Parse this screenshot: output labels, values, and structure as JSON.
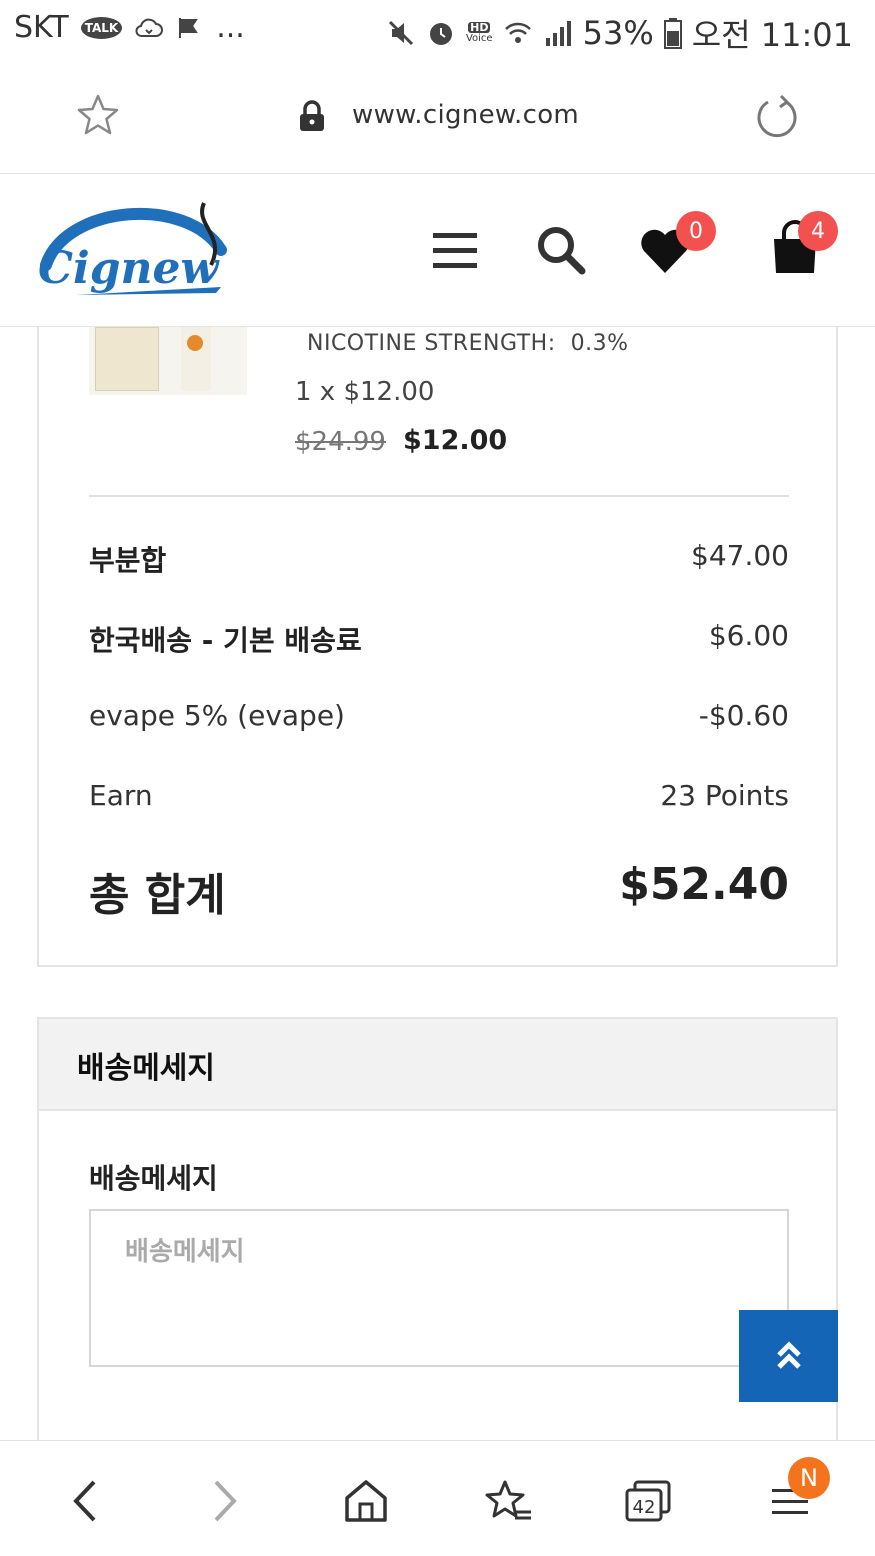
{
  "statusbar": {
    "carrier": "SKT",
    "talk_badge": "TALK",
    "more": "...",
    "hd_label": "HD",
    "voice_label": "Voice",
    "battery": "53%",
    "time": "오전 11:01"
  },
  "addressbar": {
    "url": "www.cignew.com"
  },
  "header": {
    "logo_text": "Cignew",
    "wishlist_count": "0",
    "cart_count": "4"
  },
  "order": {
    "nicotine_label": "NICOTINE STRENGTH:",
    "nicotine_value": "0.3%",
    "quantity_line": "1 x $12.00",
    "old_price": "$24.99",
    "new_price": "$12.00",
    "rows": [
      {
        "label": "부분합",
        "value": "$47.00"
      },
      {
        "label": "한국배송 - 기본 배송료",
        "value": "$6.00"
      },
      {
        "label": "evape 5% (evape)",
        "value": "-$0.60"
      },
      {
        "label": "Earn",
        "value": "23 Points"
      }
    ],
    "total_label": "총 합계",
    "total_value": "$52.40"
  },
  "shipping_message": {
    "section_title": "배송메세지",
    "field_label": "배송메세지",
    "placeholder": "배송메세지"
  },
  "bottomnav": {
    "tabs_count": "42",
    "menu_badge": "N"
  },
  "colors": {
    "brand_blue": "#1565b6",
    "badge_red": "#f35050",
    "notif_orange": "#f4741e"
  }
}
